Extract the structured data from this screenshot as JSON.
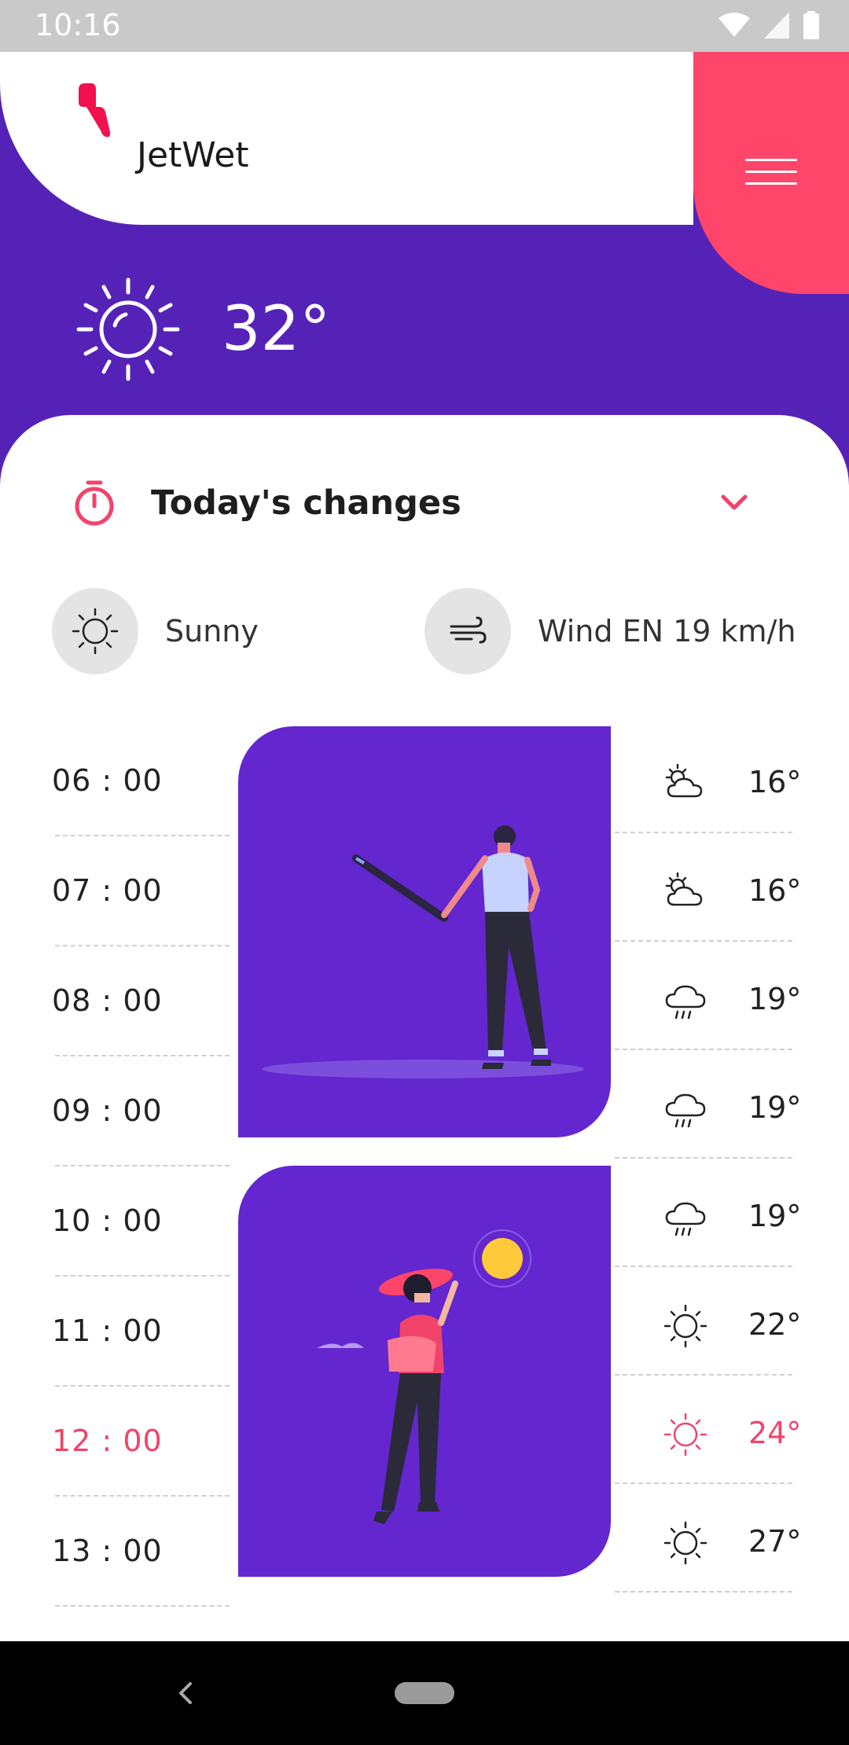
{
  "status_bar": {
    "time": "10:16"
  },
  "app": {
    "name": "JetWet"
  },
  "current": {
    "temperature": "32°",
    "icon": "sun-icon"
  },
  "changes": {
    "title": "Today's changes"
  },
  "conditions": [
    {
      "label": "Sunny",
      "icon": "sun-icon"
    },
    {
      "label": "Wind EN 19 km/h",
      "icon": "wind-icon"
    }
  ],
  "hours": [
    {
      "time": "06 : 00"
    },
    {
      "time": "07 : 00"
    },
    {
      "time": "08 : 00"
    },
    {
      "time": "09 : 00"
    },
    {
      "time": "10 : 00"
    },
    {
      "time": "11 : 00"
    },
    {
      "time": "12 : 00",
      "active": true
    },
    {
      "time": "13 : 00"
    }
  ],
  "forecast": [
    {
      "temp": "16°",
      "icon": "partly-cloudy-icon"
    },
    {
      "temp": "16°",
      "icon": "partly-cloudy-icon"
    },
    {
      "temp": "19°",
      "icon": "rain-cloud-icon"
    },
    {
      "temp": "19°",
      "icon": "rain-cloud-icon"
    },
    {
      "temp": "19°",
      "icon": "rain-cloud-icon"
    },
    {
      "temp": "22°",
      "icon": "sun-icon"
    },
    {
      "temp": "24°",
      "icon": "sun-icon",
      "active": true
    },
    {
      "temp": "27°",
      "icon": "sun-icon"
    }
  ],
  "colors": {
    "purple": "#5522B8",
    "card_purple": "#6326CF",
    "accent": "#FF4569",
    "active_text": "#F2436B"
  }
}
